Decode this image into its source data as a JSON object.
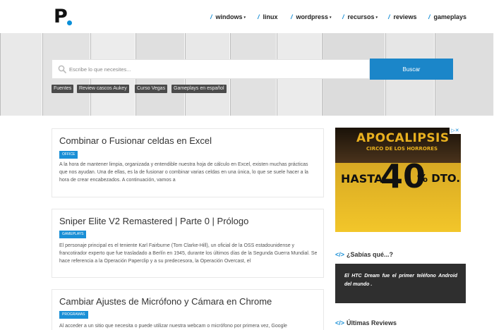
{
  "header": {
    "logo": "P",
    "nav": [
      {
        "label": "windows",
        "dropdown": true
      },
      {
        "label": "linux",
        "dropdown": false
      },
      {
        "label": "wordpress",
        "dropdown": true
      },
      {
        "label": "recursos",
        "dropdown": true
      },
      {
        "label": "reviews",
        "dropdown": false
      },
      {
        "label": "gameplays",
        "dropdown": false
      }
    ],
    "slash": "/",
    "caret": "▾"
  },
  "search": {
    "placeholder": "Escribe lo que necesites...",
    "button_label": "Buscar",
    "tags": [
      "Fuentes",
      "Review cascos Aukey",
      "Curso Vegas",
      "Gameplays en español"
    ]
  },
  "posts": [
    {
      "title": "Combinar o Fusionar celdas en Excel",
      "category": "OFFICE",
      "excerpt": "A la hora de mantener limpia, organizada y entendible nuestra hoja de cálculo en Excel, existen muchas prácticas que nos ayudan. Una de ellas, es la de fusionar o combinar varias celdas en una única, lo que se suele hacer a la hora de crear encabezados. A continuación, vamos a"
    },
    {
      "title": "Sniper Elite V2 Remastered | Parte 0 | Prólogo",
      "category": "GAMEPLAYS",
      "excerpt": "El personaje principal es el teniente Karl Fairburne (Tom Clarke-Hill), un oficial de la OSS estadounidense y francotirador experto que fue trasladado a Berlín en 1945, durante los últimos días de la Segunda Guerra Mundial. Se hace referencia a la Operación Paperclip y a su predecesora, la Operación Overcast, el"
    },
    {
      "title": "Cambiar Ajustes de Micrófono y Cámara en Chrome",
      "category": "PROGRAMAS",
      "excerpt": "Al acceder a un sitio que necesita o puede utilizar nuestra webcam o micrófono por primera vez, Google"
    }
  ],
  "sidebar": {
    "ad": {
      "title": "APOCALIPSIS",
      "subtitle": "CIRCO DE LOS HORRORES",
      "text_left": "HASTA",
      "text_big": "40",
      "text_right": "% DTO.",
      "choices": "▷✕"
    },
    "facts_title": "¿Sabías qué...?",
    "facts_text": "El HTC Dream fue el primer teléfono Android del mundo .",
    "reviews_title": "Últimas Reviews",
    "code_glyph": "</>"
  },
  "colors": {
    "accent": "#1a8fd6",
    "button": "#1b86c9",
    "tag_bg": "#4b4b4b",
    "fact_bg": "#2f2f2f"
  }
}
